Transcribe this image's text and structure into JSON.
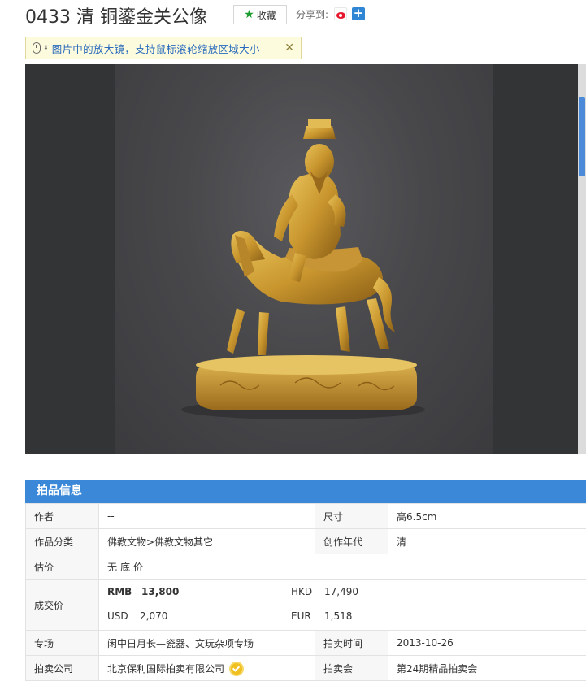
{
  "header": {
    "title": "0433 清 铜鎏金关公像",
    "favorite_label": "收藏",
    "share_label": "分享到:",
    "icons": {
      "favorite": "star-icon",
      "weibo": "weibo-icon",
      "more": "plus-icon"
    }
  },
  "tip": {
    "text": "图片中的放大镜，支持鼠标滚轮缩放区域大小",
    "close": "✕",
    "icon": "mouse-scroll-icon"
  },
  "viewer": {
    "image_description": "gilt bronze figure of Guan Gong on horseback",
    "background_color": "#333436",
    "accent_color": "#c9a03a"
  },
  "info": {
    "section_title": "拍品信息",
    "rows": {
      "author_label": "作者",
      "author_value": "--",
      "size_label": "尺寸",
      "size_value": "高6.5cm",
      "category_label": "作品分类",
      "category_value": "佛教文物>佛教文物其它",
      "year_label": "创作年代",
      "year_value": "清",
      "estimate_label": "估价",
      "estimate_value": "无底价",
      "price_label": "成交价",
      "price": {
        "rmb_label": "RMB",
        "rmb_value": "13,800",
        "hkd_label": "HKD",
        "hkd_value": "17,490",
        "usd_label": "USD",
        "usd_value": "2,070",
        "eur_label": "EUR",
        "eur_value": "1,518"
      },
      "session_label": "专场",
      "session_value": "闲中日月长—瓷器、文玩杂项专场",
      "time_label": "拍卖时间",
      "time_value": "2013-10-26",
      "company_label": "拍卖公司",
      "company_value": "北京保利国际拍卖有限公司",
      "auction_label": "拍卖会",
      "auction_value": "第24期精品拍卖会"
    }
  },
  "colors": {
    "header_blue": "#3b88d8",
    "tip_text": "#2a6bbd",
    "no_reserve": "#e02020",
    "favorite_star": "#1a9b2e"
  }
}
